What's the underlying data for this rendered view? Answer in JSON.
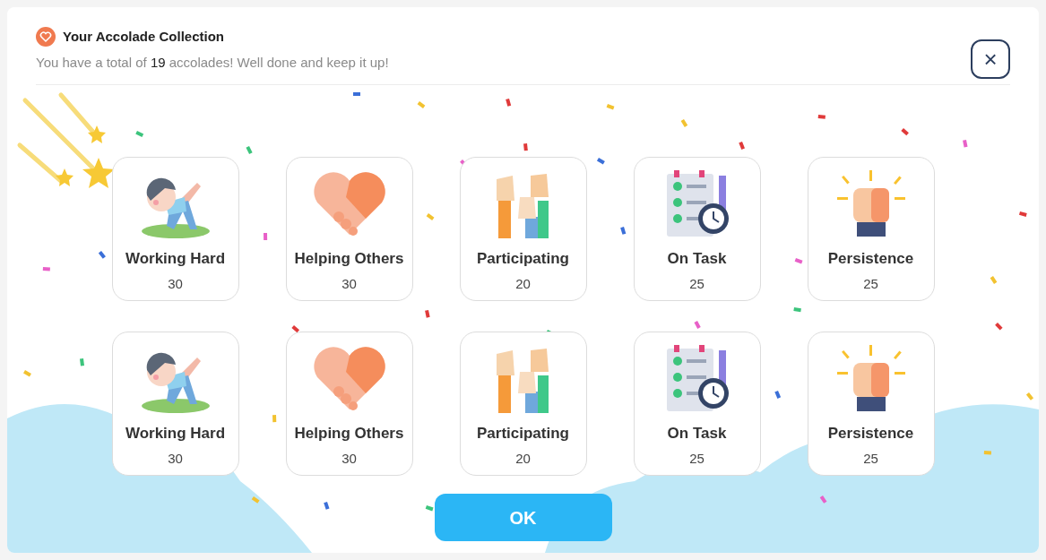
{
  "dialog": {
    "title": "Your Accolade Collection",
    "subtitle": "You have a total of **19** accolades! Well done and keep it up!",
    "close_label": "×"
  },
  "accolades": [
    {
      "kind": "exercise",
      "name": "Working Hard",
      "count": "30"
    },
    {
      "kind": "handshake",
      "name": "Helping Others",
      "count": "30"
    },
    {
      "kind": "hands",
      "name": "Participating",
      "count": "20"
    },
    {
      "kind": "checklist",
      "name": "On Task",
      "count": "25"
    },
    {
      "kind": "fist",
      "name": "Persistence",
      "count": "25"
    },
    {
      "kind": "exercise",
      "name": "Working Hard",
      "count": "30"
    },
    {
      "kind": "handshake",
      "name": "Helping Others",
      "count": "30"
    },
    {
      "kind": "hands",
      "name": "Participating",
      "count": "20"
    },
    {
      "kind": "checklist",
      "name": "On Task",
      "count": "25"
    },
    {
      "kind": "fist",
      "name": "Persistence",
      "count": "25"
    }
  ],
  "ok_button": "OK"
}
